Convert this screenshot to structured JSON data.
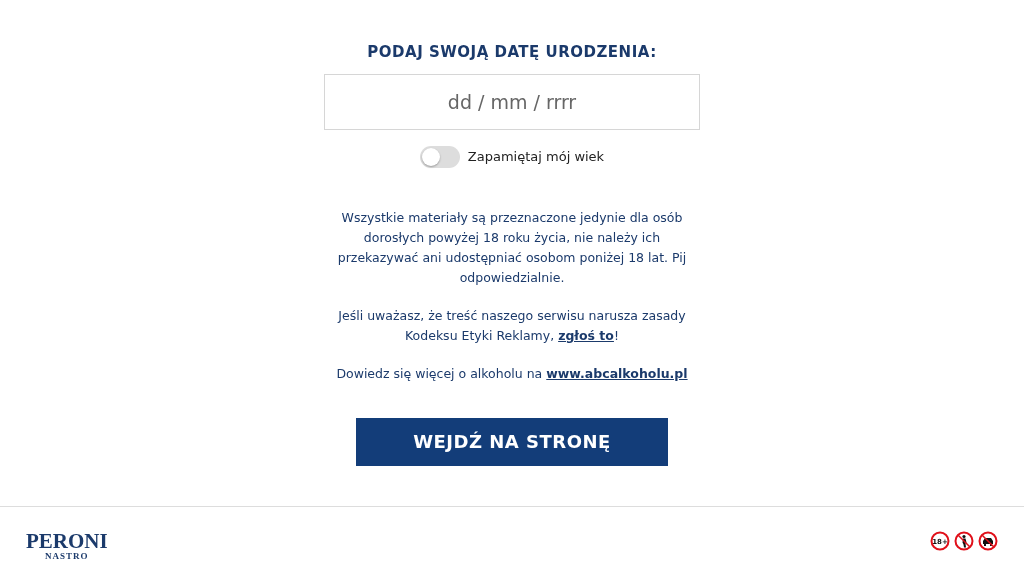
{
  "heading": "PODAJ SWOJĄ DATĘ URODZENIA:",
  "date_field": {
    "placeholder": "dd / mm / rrrr"
  },
  "remember_toggle": {
    "label": "Zapamiętaj mój wiek",
    "on": false
  },
  "notices": [
    {
      "text_before": "Wszystkie materiały są przeznaczone jedynie dla osób dorosłych powyżej 18 roku życia, nie należy ich przekazywać ani udostępniać osobom poniżej 18 lat. Pij odpowiedzialnie."
    },
    {
      "text_before": "Jeśli uważasz, że treść naszego serwisu narusza zasady Kodeksu Etyki Reklamy, ",
      "link": "zgłoś to",
      "text_after": "!"
    },
    {
      "text_before": "Dowiedz się więcej o alkoholu na ",
      "link": "www.abcalkoholu.pl"
    }
  ],
  "enter_button": "WEJDŹ NA STRONĘ",
  "footer": {
    "logo": "PERONI",
    "logo_sub": "NASTRO",
    "age_badge": "18+"
  }
}
